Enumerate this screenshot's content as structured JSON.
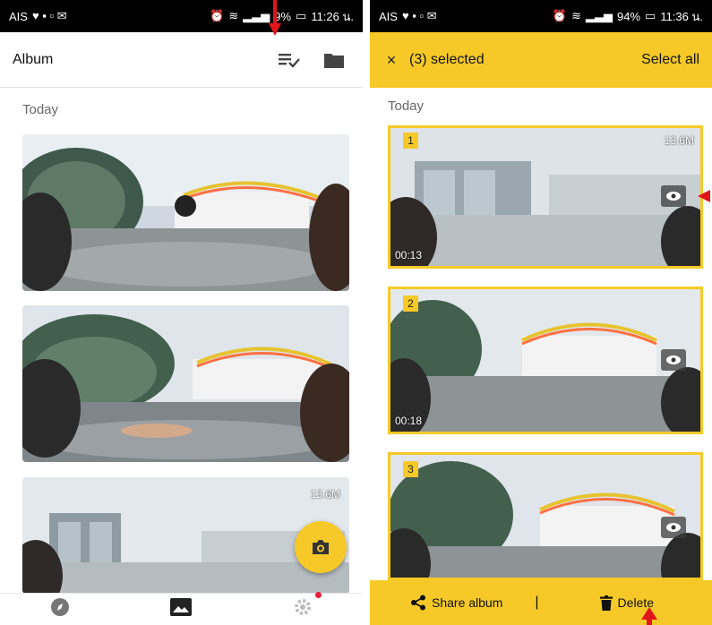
{
  "left_screen": {
    "status": {
      "carrier": "AIS",
      "battery": "9",
      "battery_suffix": "%",
      "time": "11:26 น."
    },
    "header": {
      "title": "Album"
    },
    "section_label": "Today",
    "thumbnails": [
      {
        "size": ""
      },
      {
        "size": ""
      },
      {
        "size": "13.6M"
      }
    ]
  },
  "right_screen": {
    "status": {
      "carrier": "AIS",
      "battery": "94%",
      "time": "11:36 น."
    },
    "header": {
      "close": "×",
      "selected_label": "(3) selected",
      "select_all": "Select all"
    },
    "section_label": "Today",
    "items": [
      {
        "index": "1",
        "size": "13.6M",
        "duration": "00:13"
      },
      {
        "index": "2",
        "size": "",
        "duration": "00:18"
      },
      {
        "index": "3",
        "size": "",
        "duration": ""
      }
    ],
    "actions": {
      "share": "Share album",
      "separator": "|",
      "delete": "Delete"
    }
  },
  "colors": {
    "accent": "#f6c928",
    "annotation_arrow": "#e0161b"
  },
  "icons": [
    "list-check-icon",
    "folder-icon",
    "camera-icon",
    "compass-icon",
    "gallery-icon",
    "settings-icon",
    "eye-icon",
    "share-icon",
    "trash-icon",
    "wifi-icon",
    "signal-icon",
    "battery-icon",
    "alarm-icon"
  ]
}
